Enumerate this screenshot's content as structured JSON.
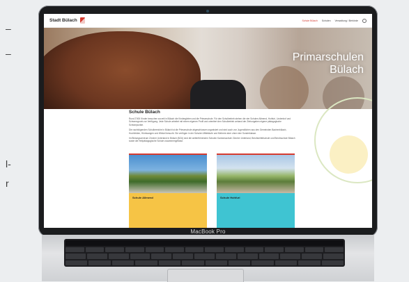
{
  "left_fragments": [
    "–",
    "–",
    "l-",
    "r"
  ],
  "laptop": {
    "model": "MacBook Pro"
  },
  "site": {
    "brand": "Stadt Bülach",
    "nav": [
      "Schule Bülach",
      "Schulen",
      "Verwaltung / Behörde"
    ],
    "hero_title_line1": "Primarschulen",
    "hero_title_line2": "Bülach",
    "heading": "Schule Bülach",
    "paragraphs": [
      "Rund 2'000 Kinder besuchen zurzeit in Bülach die Kindergärten und die Primarschule. Für den Schulbetrieb stehen die vier Schulen Allmend, Hohfuri, Lindenhof und Schwerzgrueb zur Verfügung. Jede Schule arbeitet mit einem eigenen Profil und orientiert den Schulbetrieb anhand der Zielvorgaben eigene pädagogische Schwerpunkte.",
      "Die nachfolgenden Schulbereiche in Bülach ist die Primarschule abgeschlossen organisiert und wird auch von Jugendlichen aus den Gemeinden Bachenbülach, Hochfelden, Hüntwangen und Winkel besucht. Sie verfügen in der Schulen Mittelstufe und Mehrere aber ohne eine Sonderklasse.",
      "Im Bildungszentrum Zürcher Unterland in Bülach (BZU) sind die weiterführenden Schulen Kantonsschule Zürcher Unterland, Berufsmittelschule und Berufsschule Bülach sowie die Heilpädagogische Schule zusammengefasst."
    ],
    "cards": [
      {
        "label": "Schule Allmend"
      },
      {
        "label": "Schule Hohfuri"
      }
    ]
  },
  "colors": {
    "accent": "#d53a2f",
    "card1": "#f6c445",
    "card2": "#3fc4d2"
  }
}
